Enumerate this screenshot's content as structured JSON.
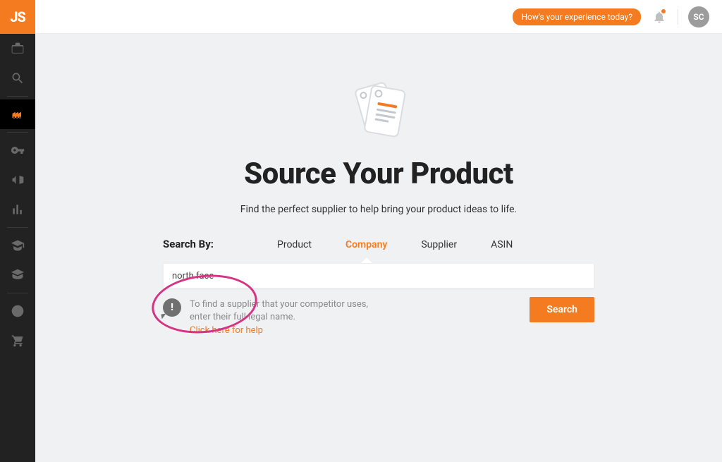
{
  "brand": {
    "logo_text": "JS"
  },
  "header": {
    "feedback_label": "How's your experience today?",
    "avatar_initials": "SC"
  },
  "sidebar": {
    "items": [
      {
        "name": "home",
        "active": false
      },
      {
        "name": "search",
        "active": false
      },
      {
        "name": "supplier-db",
        "active": true
      },
      {
        "name": "keywords",
        "active": false
      },
      {
        "name": "campaigns",
        "active": false
      },
      {
        "name": "analytics",
        "active": false
      },
      {
        "name": "academy",
        "active": false
      },
      {
        "name": "learn",
        "active": false
      },
      {
        "name": "splits",
        "active": false
      },
      {
        "name": "cart",
        "active": false
      }
    ]
  },
  "page": {
    "title": "Source Your Product",
    "subtitle": "Find the perfect supplier to help bring your product ideas to life.",
    "search_by_label": "Search By:",
    "tabs": [
      {
        "label": "Product",
        "active": false
      },
      {
        "label": "Company",
        "active": true
      },
      {
        "label": "Supplier",
        "active": false
      },
      {
        "label": "ASIN",
        "active": false
      }
    ],
    "search_value": "north face",
    "search_placeholder": "",
    "hint_line1": "To find a supplier that your competitor uses,",
    "hint_line2": "enter their full legal name.",
    "help_link": "Click here for help",
    "search_button": "Search"
  },
  "colors": {
    "accent": "#f47b20",
    "annotation": "#d63384"
  }
}
